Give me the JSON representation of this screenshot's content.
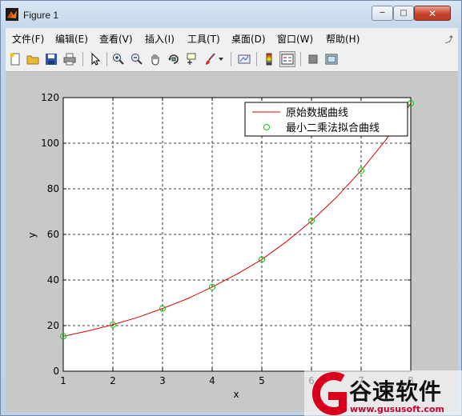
{
  "window": {
    "title": "Figure 1"
  },
  "menu": [
    "文件(F)",
    "编辑(E)",
    "查看(V)",
    "插入(I)",
    "工具(T)",
    "桌面(D)",
    "窗口(W)",
    "帮助(H)"
  ],
  "toolbar_icons": [
    "new-figure-icon",
    "open-file-icon",
    "save-icon",
    "print-icon",
    "edit-plot-arrow-icon",
    "zoom-in-icon",
    "zoom-out-icon",
    "pan-hand-icon",
    "rotate-3d-icon",
    "data-cursor-icon",
    "brush-icon",
    "link-plot-icon",
    "colorbar-icon",
    "legend-icon",
    "hide-plot-tools-icon",
    "show-plot-tools-icon"
  ],
  "chart_data": {
    "type": "line",
    "title": "",
    "xlabel": "x",
    "ylabel": "y",
    "xlim": [
      1,
      8
    ],
    "ylim": [
      0,
      120
    ],
    "xticks": [
      "1",
      "2",
      "3",
      "4",
      "5",
      "6",
      "7",
      "8"
    ],
    "yticks": [
      "0",
      "20",
      "40",
      "60",
      "80",
      "100",
      "120"
    ],
    "grid": true,
    "grid_style": "dashed",
    "legend_position": "top-right",
    "series": [
      {
        "name": "原始数据曲线",
        "style": "line",
        "color": "#dd0000",
        "x": [
          1,
          1.5,
          2,
          2.5,
          3,
          3.5,
          4,
          4.5,
          5,
          5.5,
          6,
          6.5,
          7,
          7.5,
          8
        ],
        "y": [
          15.3,
          17.7,
          20.4,
          23.6,
          27.5,
          31.8,
          36.9,
          42.6,
          49.0,
          56.9,
          65.9,
          76.2,
          88.0,
          101.5,
          117.5
        ]
      },
      {
        "name": "最小二乘法拟合曲线",
        "style": "markers",
        "marker": "circle",
        "color": "#00cc00",
        "x": [
          1,
          2,
          3,
          4,
          5,
          6,
          7,
          8
        ],
        "y": [
          15.3,
          20.4,
          27.5,
          36.9,
          49.0,
          66.0,
          88.0,
          117.5
        ]
      }
    ]
  },
  "watermark": {
    "brand": "谷速软件",
    "url": "www.gususoft.com"
  }
}
